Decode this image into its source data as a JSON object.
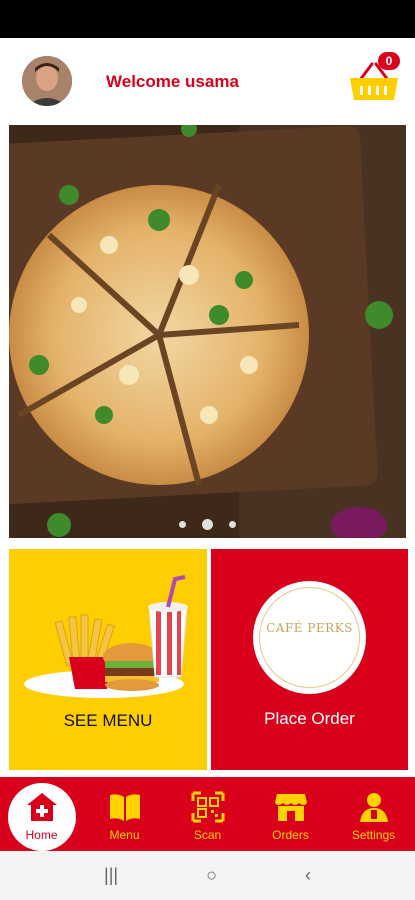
{
  "header": {
    "welcome_text": "Welcome usama",
    "cart_count": "0"
  },
  "banner": {
    "image_subject": "pizza",
    "slides": 3,
    "active_slide": 2
  },
  "tiles": {
    "menu_label": "SEE MENU",
    "order_label": "Place Order",
    "logo_text": "CAFÉ PERKS"
  },
  "nav": {
    "items": [
      {
        "label": "Home",
        "icon": "home-icon"
      },
      {
        "label": "Menu",
        "icon": "book-icon"
      },
      {
        "label": "Scan",
        "icon": "qr-code-icon"
      },
      {
        "label": "Orders",
        "icon": "store-icon"
      },
      {
        "label": "Settings",
        "icon": "user-icon"
      }
    ]
  },
  "system_nav": {
    "recents": "|||",
    "home": "○",
    "back": "‹"
  },
  "colors": {
    "brand_red": "#d9001b",
    "brand_yellow": "#ffce00",
    "nav_icon_yellow": "#ffd200"
  }
}
